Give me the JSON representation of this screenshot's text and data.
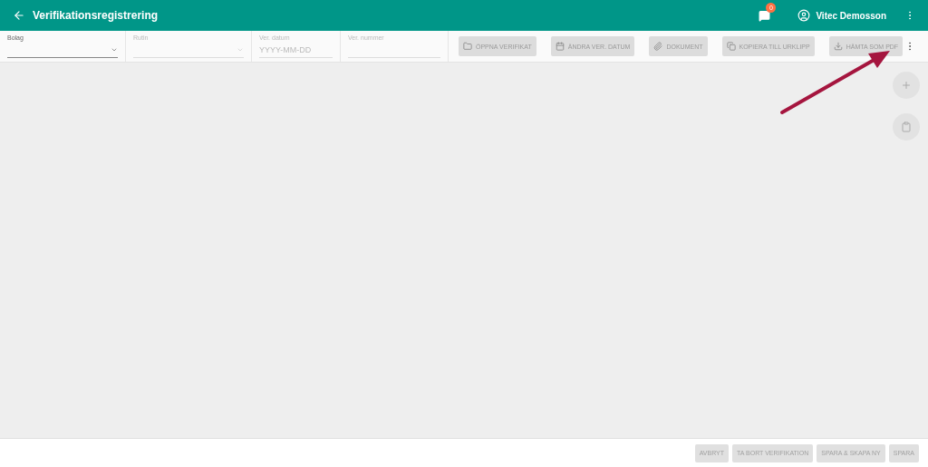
{
  "app_bar": {
    "title": "Verifikationsregistrering",
    "notifications_badge": "0",
    "user": "Vitec Demosson"
  },
  "toolbar": {
    "fields": [
      {
        "kind": "dropdown",
        "label": "Bolag",
        "disabled": false
      },
      {
        "kind": "dropdown",
        "label": "Rutin",
        "disabled": true
      },
      {
        "kind": "text",
        "label": "Ver. datum",
        "placeholder": "YYYY-MM-DD",
        "disabled": true
      },
      {
        "kind": "text",
        "label": "Ver. nummer",
        "disabled": true
      }
    ],
    "buttons": [
      {
        "kind": "folder",
        "label": "ÖPPNA VERIFIKAT",
        "disabled": true
      },
      {
        "kind": "calendar",
        "label": "ÄNDRA VER. DATUM",
        "disabled": true
      },
      {
        "kind": "paperclip",
        "label": "DOKUMENT",
        "disabled": true
      },
      {
        "kind": "copy",
        "label": "KOPIERA TILL URKLIPP",
        "disabled": true
      },
      {
        "kind": "download",
        "label": "HÄMTA SOM PDF",
        "disabled": true
      }
    ]
  },
  "side_actions": [
    {
      "kind": "add"
    },
    {
      "kind": "clipboard"
    }
  ],
  "footer_buttons": [
    {
      "label": "AVBRYT",
      "disabled": true
    },
    {
      "label": "TA BORT VERIFIKATION",
      "disabled": true
    },
    {
      "label": "SPARA & SKAPA NY",
      "disabled": true
    },
    {
      "label": "SPARA",
      "disabled": true
    }
  ]
}
